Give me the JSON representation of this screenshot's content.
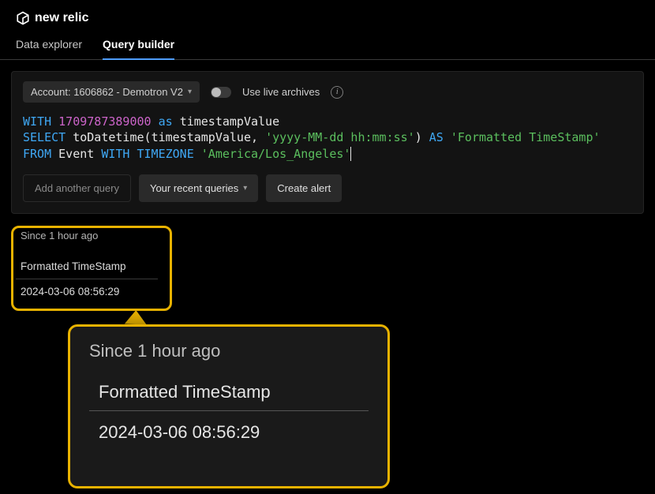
{
  "brand": "new relic",
  "tabs": {
    "data_explorer": "Data explorer",
    "query_builder": "Query builder"
  },
  "account_picker": "Account: 1606862 - Demotron V2",
  "live_archives_label": "Use live archives",
  "query": {
    "with_kw": "WITH",
    "timestamp_num": "1709787389000",
    "as_kw": "as",
    "ts_ident": "timestampValue",
    "select_kw": "SELECT",
    "func": "toDatetime",
    "arg_ident": "timestampValue",
    "fmt_str": "'yyyy-MM-dd hh:mm:ss'",
    "as_kw2": "AS",
    "alias_str": "'Formatted TimeStamp'",
    "from_kw": "FROM",
    "event_ident": "Event",
    "with_tz_kw": "WITH TIMEZONE",
    "tz_str": "'America/Los_Angeles'"
  },
  "buttons": {
    "add_query": "Add another query",
    "recent": "Your recent queries",
    "create_alert": "Create alert"
  },
  "results": {
    "since": "Since 1 hour ago",
    "column": "Formatted TimeStamp",
    "value": "2024-03-06 08:56:29"
  }
}
